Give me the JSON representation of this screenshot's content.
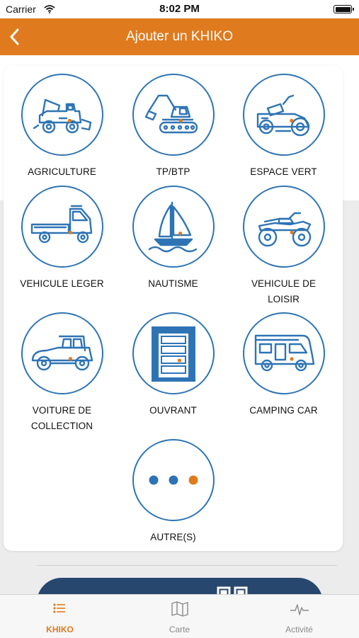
{
  "status_bar": {
    "carrier": "Carrier",
    "time": "8:02 PM"
  },
  "nav": {
    "title": "Ajouter un KHIKO",
    "back_icon": "chevron-left-icon"
  },
  "colors": {
    "accent": "#df7b1e",
    "icon_blue": "#2e74b5",
    "dark_button": "#27476e"
  },
  "categories": [
    {
      "label": "AGRICULTURE",
      "icon": "harvester-icon"
    },
    {
      "label": "TP/BTP",
      "icon": "excavator-icon"
    },
    {
      "label": "ESPACE VERT",
      "icon": "lawn-tractor-icon"
    },
    {
      "label": "VEHICULE LEGER",
      "icon": "truck-icon"
    },
    {
      "label": "NAUTISME",
      "icon": "sailboat-icon"
    },
    {
      "label": "VEHICULE DE\nLOISIR",
      "icon": "quad-bike-icon"
    },
    {
      "label": "VOITURE DE\nCOLLECTION",
      "icon": "vintage-car-icon"
    },
    {
      "label": "OUVRANT",
      "icon": "garage-door-icon"
    },
    {
      "label": "CAMPING CAR",
      "icon": "camper-van-icon"
    },
    {
      "label": "AUTRE(S)",
      "icon": "more-dots-icon"
    }
  ],
  "tabs": [
    {
      "label": "KHIKO",
      "icon": "list-icon",
      "active": true
    },
    {
      "label": "Carte",
      "icon": "map-icon",
      "active": false
    },
    {
      "label": "Activité",
      "icon": "activity-icon",
      "active": false
    }
  ]
}
